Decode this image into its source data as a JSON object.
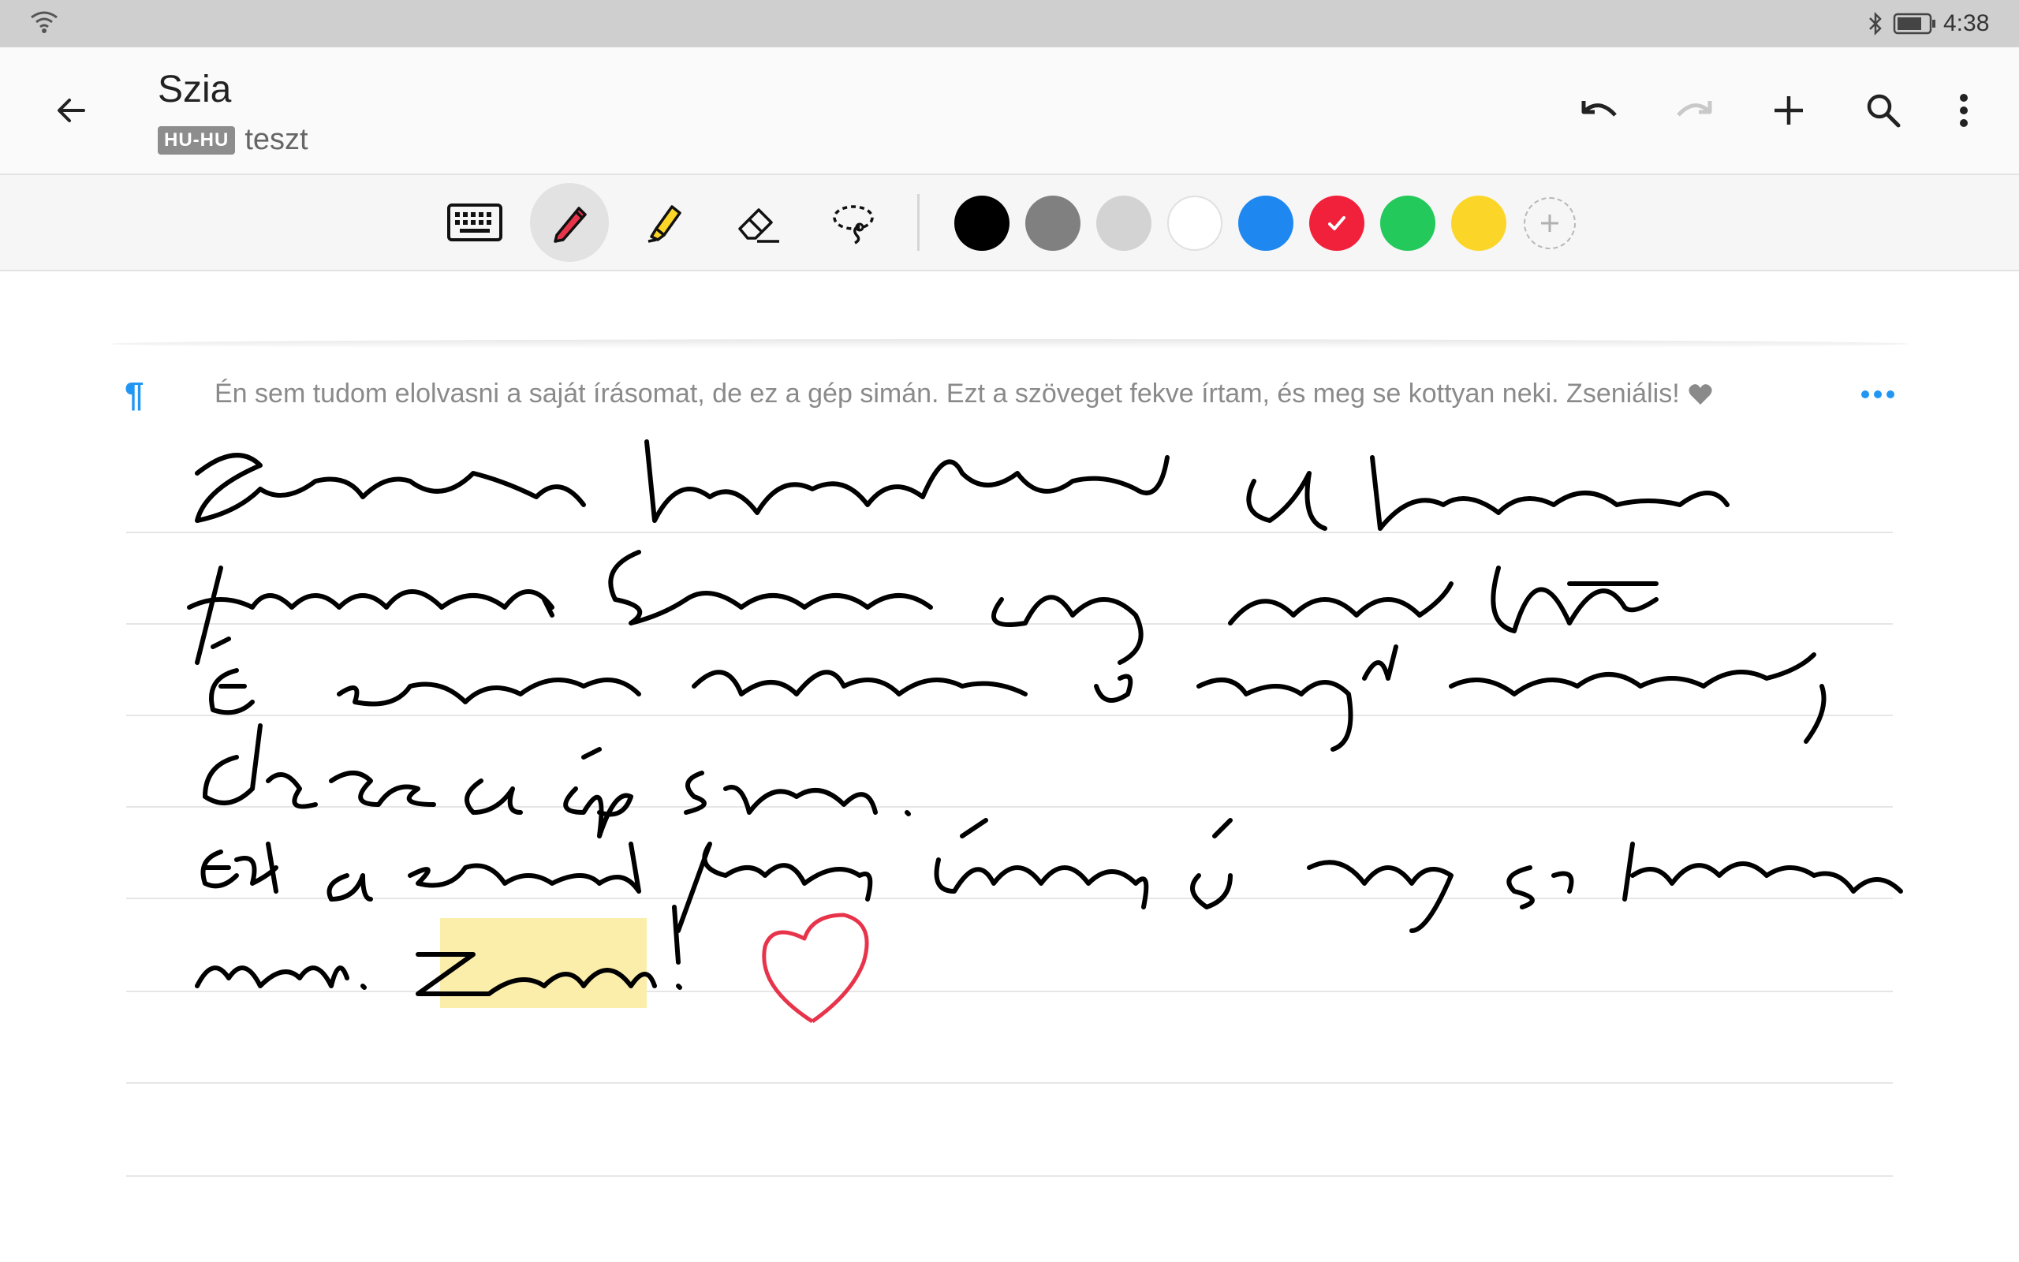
{
  "status_bar": {
    "time": "4:38"
  },
  "header": {
    "title": "Szia",
    "language_badge": "HU-HU",
    "note_name": "teszt"
  },
  "toolbar": {
    "tools": [
      "keyboard-icon",
      "pen-icon",
      "highlighter-icon",
      "eraser-icon",
      "lasso-icon"
    ],
    "active_tool": "pen",
    "colors": [
      "#000000",
      "#808080",
      "#d3d3d3",
      "#ffffff",
      "#1e88f0",
      "#f2213b",
      "#23c95a",
      "#fbd629"
    ],
    "selected_color": "#f2213b"
  },
  "canvas": {
    "recognized_text": "Én sem tudom elolvasni a saját írásomat, de ez a gép simán. Ezt a szöveget fekve írtam, és meg se kottyan neki. Zseniális!",
    "handwriting_lines": [
      "Szeretném kipróbálni a kézírás",
      "funkciót. Számomra elég menő lett.",
      "Én sem tudom elolvasni a saját írásomat,",
      "de ez a gép simán.",
      "Ezt a szöveget fekve írtam és meg se kottyan",
      "neki. Zseniális!"
    ],
    "highlight_color": "#fbeeaa",
    "ink_color": "#000000",
    "heart_color": "#e8344b"
  }
}
